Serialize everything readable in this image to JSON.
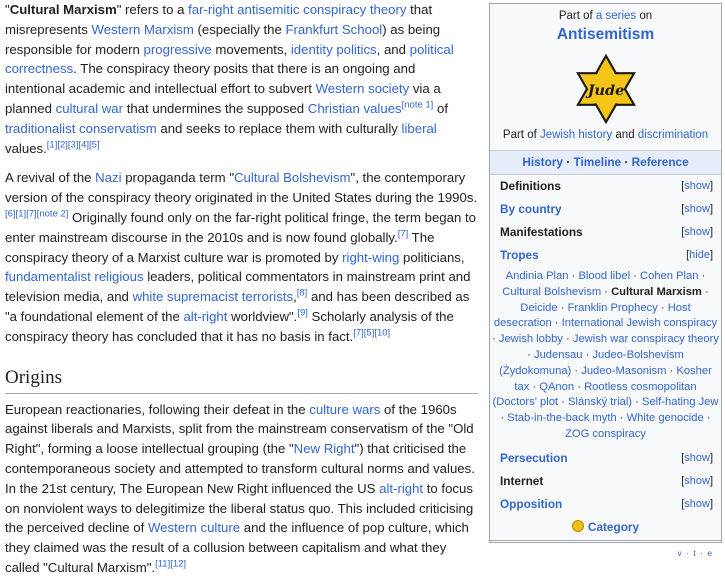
{
  "article": {
    "p1": {
      "term": "Cultural Marxism",
      "t1": "\" refers to a ",
      "l1": "far-right antisemitic conspiracy theory",
      "t2": " that misrepresents ",
      "l2": "Western Marxism",
      "t3": " (especially the ",
      "l3": "Frankfurt School",
      "t4": ") as being responsible for modern ",
      "l4": "progressive",
      "t5": " movements, ",
      "l5": "identity politics",
      "t6": ", and ",
      "l6": "political correctness",
      "t7": ". The conspiracy theory posits that there is an ongoing and intentional academic and intellectual effort to subvert ",
      "l7": "Western society",
      "t8": " via a planned ",
      "l8": "cultural war",
      "t9": " that undermines the supposed ",
      "l9": "Christian values",
      "r1": "[note 1]",
      "t10": " of ",
      "l10": "traditionalist conservatism",
      "t11": " and seeks to replace them with culturally ",
      "l11": "liberal",
      "t12": " values.",
      "r2": "[1][2][3][4][5]"
    },
    "p2": {
      "t1": "A revival of the ",
      "l1": "Nazi",
      "t2": " propaganda term \"",
      "l2": "Cultural Bolshevism",
      "t3": "\", the contemporary version of the conspiracy theory originated in the United States during the 1990s.",
      "r1": "[6][1][7][note 2]",
      "t4": " Originally found only on the far-right political fringe, the term began to enter mainstream discourse in the 2010s and is now found globally.",
      "r2": "[7]",
      "t5": " The conspiracy theory of a Marxist culture war is promoted by ",
      "l3": "right-wing",
      "t6": " politicians, ",
      "l4": "fundamentalist religious",
      "t7": " leaders, political commentators in mainstream print and television media, and ",
      "l5": "white supremacist terrorists",
      "r3": "[8]",
      "t8": " and has been described as \"a foundational element of the ",
      "l6": "alt-right",
      "t9": " worldview\".",
      "r4": "[9]",
      "t10": " Scholarly analysis of the conspiracy theory has concluded that it has no basis in fact.",
      "r5": "[7][5][10]"
    },
    "heading": "Origins",
    "p3": {
      "t1": "European reactionaries, following their defeat in the ",
      "l1": "culture wars",
      "t2": " of the 1960s against liberals and Marxists, split from the mainstream conservatism of the \"Old Right\", forming a loose intellectual grouping (the \"",
      "l2": "New Right",
      "t3": "\") that criticised the contemporaneous society and attempted to transform cultural norms and values. In the 21st century, The European New Right influenced the US ",
      "l3": "alt-right",
      "t4": " to focus on nonviolent ways to delegitimize the liberal status quo. This included criticising the perceived decline of ",
      "l4": "Western culture",
      "t5": " and the influence of pop culture, which they claimed was the result of a collusion between capitalism and what they called \"Cultural Marxism\".",
      "r1": "[11][12]"
    }
  },
  "sidebar": {
    "part_of": "Part of ",
    "a_series": "a series",
    "on": " on",
    "title": "Antisemitism",
    "image_text": "Jude",
    "below_pre": "Part of ",
    "below_l1": "Jewish history",
    "below_and": " and ",
    "below_l2": "discrimination",
    "nav": [
      "History",
      "Timeline",
      "Reference"
    ],
    "sections": [
      {
        "label": "Definitions",
        "toggle": "show",
        "color": "black"
      },
      {
        "label": "By country",
        "toggle": "show",
        "color": "blue"
      },
      {
        "label": "Manifestations",
        "toggle": "show",
        "color": "black"
      },
      {
        "label": "Tropes",
        "toggle": "hide",
        "color": "blue"
      },
      {
        "label": "Persecution",
        "toggle": "show",
        "color": "blue"
      },
      {
        "label": "Internet",
        "toggle": "show",
        "color": "black"
      },
      {
        "label": "Opposition",
        "toggle": "show",
        "color": "blue"
      }
    ],
    "tropes": [
      "Andinia Plan",
      "Blood libel",
      "Cohen Plan",
      "Cultural Bolshevism",
      "Cultural Marxism",
      "Deicide",
      "Franklin Prophecy",
      "Host desecration",
      "International Jewish conspiracy",
      "Jewish lobby",
      "Jewish war conspiracy theory",
      "Judensau",
      "Judeo-Bolshevism (Żydokomuna)",
      "Judeo-Masonism",
      "Kosher tax",
      "QAnon",
      "Rootless cosmopolitan (Doctors' plot",
      "Slánský trial)",
      "Self-hating Jew",
      "Stab-in-the-back myth",
      "White genocide",
      "ZOG conspiracy"
    ],
    "current_trope": "Cultural Marxism",
    "category": "Category",
    "vte": "v · t · e",
    "star_color": "#f5c518"
  }
}
